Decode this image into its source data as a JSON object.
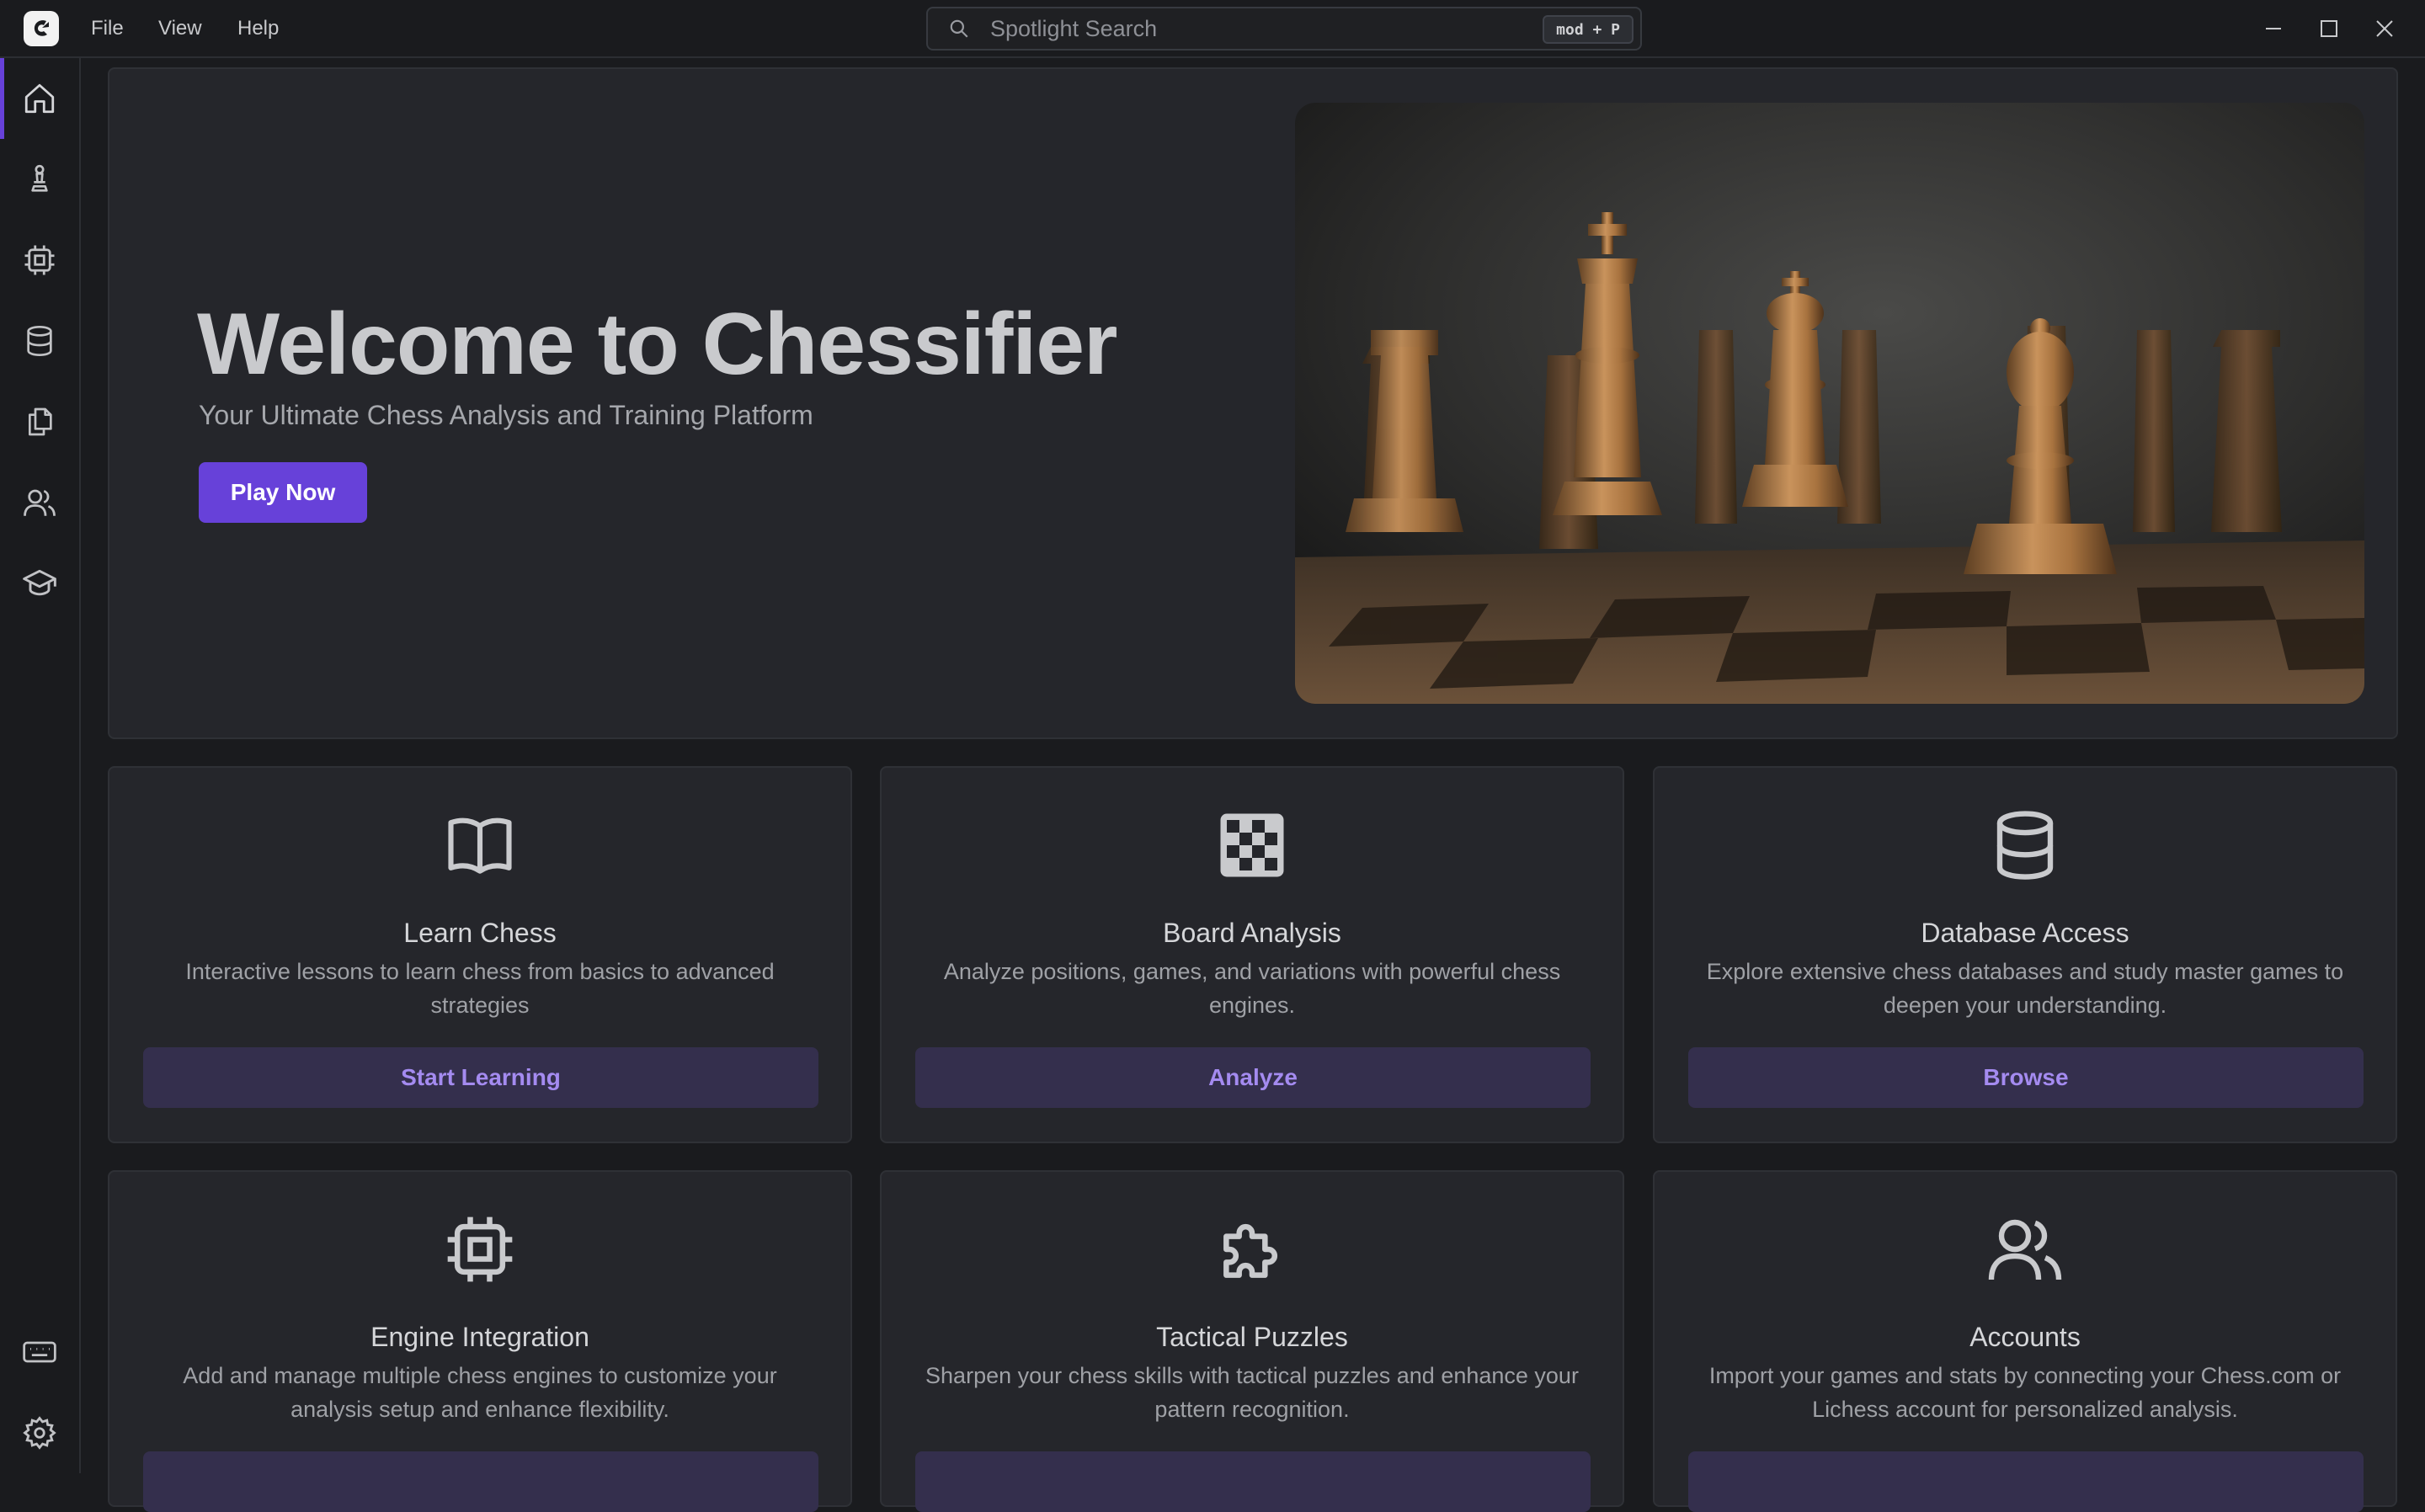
{
  "app": {
    "menu": [
      "File",
      "View",
      "Help"
    ],
    "search": {
      "placeholder": "Spotlight Search",
      "shortcut": "mod + P"
    }
  },
  "sidebar": {
    "items": [
      {
        "icon": "home-icon",
        "active": true
      },
      {
        "icon": "chess-pawn-icon"
      },
      {
        "icon": "cpu-icon"
      },
      {
        "icon": "database-icon"
      },
      {
        "icon": "files-icon"
      },
      {
        "icon": "users-icon"
      },
      {
        "icon": "graduation-cap-icon"
      }
    ],
    "bottom": [
      {
        "icon": "keyboard-icon"
      },
      {
        "icon": "settings-icon"
      }
    ]
  },
  "hero": {
    "title": "Welcome to Chessifier",
    "subtitle": "Your Ultimate Chess Analysis and Training Platform",
    "button": "Play Now"
  },
  "cards": [
    {
      "icon": "book-icon",
      "title": "Learn Chess",
      "description": "Interactive lessons to learn chess from basics to advanced strategies",
      "button": "Start Learning"
    },
    {
      "icon": "chessboard-icon",
      "title": "Board Analysis",
      "description": "Analyze positions, games, and variations with powerful chess engines.",
      "button": "Analyze"
    },
    {
      "icon": "database-icon",
      "title": "Database Access",
      "description": "Explore extensive chess databases and study master games to deepen your understanding.",
      "button": "Browse"
    },
    {
      "icon": "cpu-icon",
      "title": "Engine Integration",
      "description": "Add and manage multiple chess engines to customize your analysis setup and enhance flexibility.",
      "button": ""
    },
    {
      "icon": "puzzle-icon",
      "title": "Tactical Puzzles",
      "description": "Sharpen your chess skills with tactical puzzles and enhance your pattern recognition.",
      "button": ""
    },
    {
      "icon": "users-icon",
      "title": "Accounts",
      "description": "Import your games and stats by connecting your Chess.com or Lichess account for personalized analysis.",
      "button": ""
    }
  ],
  "colors": {
    "accent": "#6741d9",
    "background": "#1a1b1e",
    "card": "#25262b",
    "card_button_bg": "#342f4d",
    "card_button_text": "#a48bf0"
  }
}
